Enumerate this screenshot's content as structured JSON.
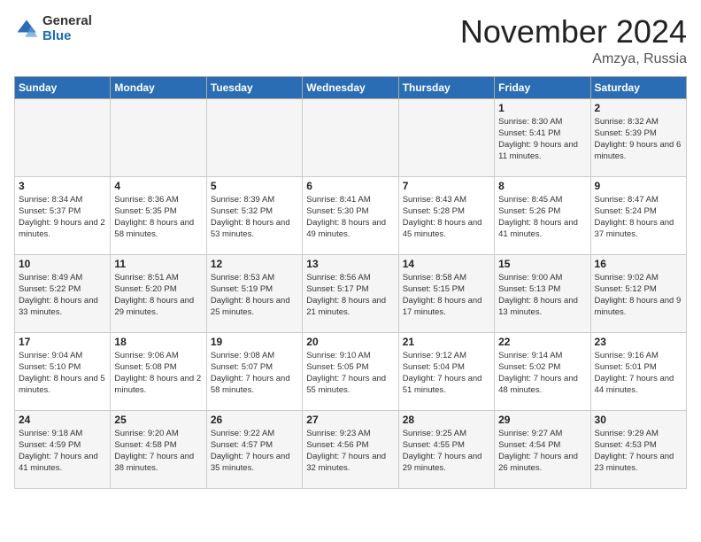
{
  "logo": {
    "general": "General",
    "blue": "Blue"
  },
  "title": "November 2024",
  "location": "Amzya, Russia",
  "days_of_week": [
    "Sunday",
    "Monday",
    "Tuesday",
    "Wednesday",
    "Thursday",
    "Friday",
    "Saturday"
  ],
  "weeks": [
    [
      {
        "day": "",
        "info": ""
      },
      {
        "day": "",
        "info": ""
      },
      {
        "day": "",
        "info": ""
      },
      {
        "day": "",
        "info": ""
      },
      {
        "day": "",
        "info": ""
      },
      {
        "day": "1",
        "info": "Sunrise: 8:30 AM\nSunset: 5:41 PM\nDaylight: 9 hours and 11 minutes."
      },
      {
        "day": "2",
        "info": "Sunrise: 8:32 AM\nSunset: 5:39 PM\nDaylight: 9 hours and 6 minutes."
      }
    ],
    [
      {
        "day": "3",
        "info": "Sunrise: 8:34 AM\nSunset: 5:37 PM\nDaylight: 9 hours and 2 minutes."
      },
      {
        "day": "4",
        "info": "Sunrise: 8:36 AM\nSunset: 5:35 PM\nDaylight: 8 hours and 58 minutes."
      },
      {
        "day": "5",
        "info": "Sunrise: 8:39 AM\nSunset: 5:32 PM\nDaylight: 8 hours and 53 minutes."
      },
      {
        "day": "6",
        "info": "Sunrise: 8:41 AM\nSunset: 5:30 PM\nDaylight: 8 hours and 49 minutes."
      },
      {
        "day": "7",
        "info": "Sunrise: 8:43 AM\nSunset: 5:28 PM\nDaylight: 8 hours and 45 minutes."
      },
      {
        "day": "8",
        "info": "Sunrise: 8:45 AM\nSunset: 5:26 PM\nDaylight: 8 hours and 41 minutes."
      },
      {
        "day": "9",
        "info": "Sunrise: 8:47 AM\nSunset: 5:24 PM\nDaylight: 8 hours and 37 minutes."
      }
    ],
    [
      {
        "day": "10",
        "info": "Sunrise: 8:49 AM\nSunset: 5:22 PM\nDaylight: 8 hours and 33 minutes."
      },
      {
        "day": "11",
        "info": "Sunrise: 8:51 AM\nSunset: 5:20 PM\nDaylight: 8 hours and 29 minutes."
      },
      {
        "day": "12",
        "info": "Sunrise: 8:53 AM\nSunset: 5:19 PM\nDaylight: 8 hours and 25 minutes."
      },
      {
        "day": "13",
        "info": "Sunrise: 8:56 AM\nSunset: 5:17 PM\nDaylight: 8 hours and 21 minutes."
      },
      {
        "day": "14",
        "info": "Sunrise: 8:58 AM\nSunset: 5:15 PM\nDaylight: 8 hours and 17 minutes."
      },
      {
        "day": "15",
        "info": "Sunrise: 9:00 AM\nSunset: 5:13 PM\nDaylight: 8 hours and 13 minutes."
      },
      {
        "day": "16",
        "info": "Sunrise: 9:02 AM\nSunset: 5:12 PM\nDaylight: 8 hours and 9 minutes."
      }
    ],
    [
      {
        "day": "17",
        "info": "Sunrise: 9:04 AM\nSunset: 5:10 PM\nDaylight: 8 hours and 5 minutes."
      },
      {
        "day": "18",
        "info": "Sunrise: 9:06 AM\nSunset: 5:08 PM\nDaylight: 8 hours and 2 minutes."
      },
      {
        "day": "19",
        "info": "Sunrise: 9:08 AM\nSunset: 5:07 PM\nDaylight: 7 hours and 58 minutes."
      },
      {
        "day": "20",
        "info": "Sunrise: 9:10 AM\nSunset: 5:05 PM\nDaylight: 7 hours and 55 minutes."
      },
      {
        "day": "21",
        "info": "Sunrise: 9:12 AM\nSunset: 5:04 PM\nDaylight: 7 hours and 51 minutes."
      },
      {
        "day": "22",
        "info": "Sunrise: 9:14 AM\nSunset: 5:02 PM\nDaylight: 7 hours and 48 minutes."
      },
      {
        "day": "23",
        "info": "Sunrise: 9:16 AM\nSunset: 5:01 PM\nDaylight: 7 hours and 44 minutes."
      }
    ],
    [
      {
        "day": "24",
        "info": "Sunrise: 9:18 AM\nSunset: 4:59 PM\nDaylight: 7 hours and 41 minutes."
      },
      {
        "day": "25",
        "info": "Sunrise: 9:20 AM\nSunset: 4:58 PM\nDaylight: 7 hours and 38 minutes."
      },
      {
        "day": "26",
        "info": "Sunrise: 9:22 AM\nSunset: 4:57 PM\nDaylight: 7 hours and 35 minutes."
      },
      {
        "day": "27",
        "info": "Sunrise: 9:23 AM\nSunset: 4:56 PM\nDaylight: 7 hours and 32 minutes."
      },
      {
        "day": "28",
        "info": "Sunrise: 9:25 AM\nSunset: 4:55 PM\nDaylight: 7 hours and 29 minutes."
      },
      {
        "day": "29",
        "info": "Sunrise: 9:27 AM\nSunset: 4:54 PM\nDaylight: 7 hours and 26 minutes."
      },
      {
        "day": "30",
        "info": "Sunrise: 9:29 AM\nSunset: 4:53 PM\nDaylight: 7 hours and 23 minutes."
      }
    ]
  ]
}
